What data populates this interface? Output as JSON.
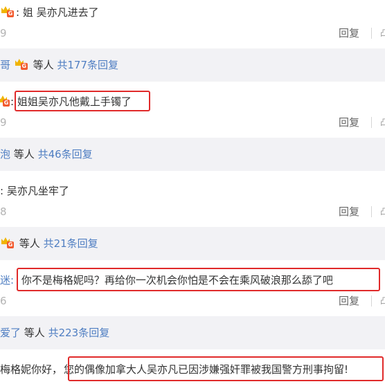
{
  "comments": [
    {
      "prefix": ":",
      "text": "姐 吴亦凡进去了",
      "time_fragment": "9",
      "reply_label": "回复",
      "replies_summary": {
        "user_fragment": "哥",
        "others": "等人",
        "count_text": "共177条回复"
      }
    },
    {
      "prefix": ":",
      "text": "姐姐吴亦凡他戴上手镯了",
      "time_fragment": "9",
      "reply_label": "回复",
      "replies_summary": {
        "user_fragment": "泡",
        "others": "等人",
        "count_text": "共46条回复"
      }
    },
    {
      "prefix": ":",
      "text": "吴亦凡坐牢了",
      "time_fragment": "8",
      "reply_label": "回复",
      "replies_summary": {
        "user_fragment": "",
        "others": "等人",
        "count_text": "共21条回复"
      }
    },
    {
      "prefix": "迷:",
      "text": "你不是梅格妮吗？再给你一次机会你怕是不会在乘风破浪那么舔了吧",
      "time_fragment": "6",
      "reply_label": "回复",
      "replies_summary": {
        "user_fragment": "爱了",
        "others": "等人",
        "count_text": "共223条回复"
      }
    },
    {
      "prefix": "梅格妮你好，",
      "text": "您的偶像加拿大人吴亦凡已因涉嫌强奸罪被我国警方刑事拘留!"
    }
  ],
  "icons": {
    "vip": "vip-crown-badge-icon",
    "like": "like-thumb-icon"
  },
  "colors": {
    "link": "#4f7ec2",
    "highlight_box": "#e02a2a",
    "band": "#f2f2f5"
  }
}
